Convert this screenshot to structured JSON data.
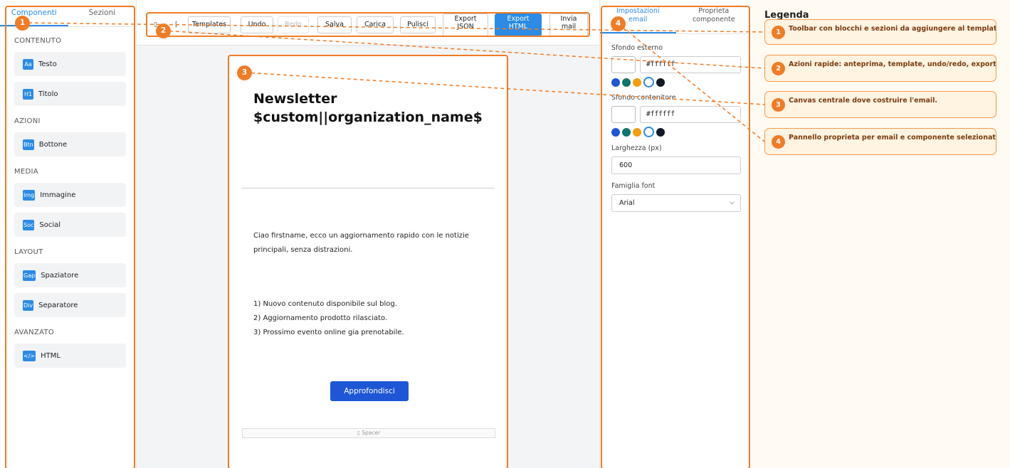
{
  "sidebar": {
    "tabs": [
      "Componenti",
      "Sezioni"
    ],
    "sections": [
      {
        "title": "CONTENUTO",
        "items": [
          {
            "chip": "Aa",
            "label": "Testo"
          },
          {
            "chip": "H1",
            "label": "Titolo"
          }
        ]
      },
      {
        "title": "AZIONI",
        "items": [
          {
            "chip": "Btn",
            "label": "Bottone"
          }
        ]
      },
      {
        "title": "MEDIA",
        "items": [
          {
            "chip": "Img",
            "label": "Immagine"
          },
          {
            "chip": "Soc",
            "label": "Social"
          }
        ]
      },
      {
        "title": "LAYOUT",
        "items": [
          {
            "chip": "Gap",
            "label": "Spaziatore"
          },
          {
            "chip": "Div",
            "label": "Separatore"
          }
        ]
      },
      {
        "title": "AVANZATO",
        "items": [
          {
            "chip": "</>",
            "label": "HTML"
          }
        ]
      }
    ]
  },
  "toolbar": {
    "icon_a": "▯",
    "icon_b": "[",
    "templates": "Templates",
    "undo": "Undo",
    "redo": "Redo",
    "salva": "Salva",
    "carica": "Carica",
    "pulisci": "Pulisci",
    "export_json": [
      "Export",
      "JSON"
    ],
    "export_html": [
      "Export",
      "HTML"
    ],
    "invia_mail": [
      "Invia",
      "mail"
    ]
  },
  "email": {
    "title": "Newsletter $custom||organization_name$",
    "paragraph": "Ciao firstname, ecco un aggiornamento rapido con le notizie principali, senza distrazioni.",
    "list": [
      "1) Nuovo contenuto disponibile sul blog.",
      "2) Aggiornamento prodotto rilasciato.",
      "3) Prossimo evento online gia prenotabile."
    ],
    "cta": "Approfondisci",
    "spacer": "▯ Spacer"
  },
  "props": {
    "tabs": [
      [
        "Impostazioni",
        "email"
      ],
      [
        "Proprieta",
        "componente"
      ]
    ],
    "outer_bg_label": "Sfondo esterno",
    "outer_bg_value": "#ffffff",
    "container_bg_label": "Sfondo contenitore",
    "container_bg_value": "#ffffff",
    "palette": [
      "#1e56d6",
      "#0f766e",
      "#f59e0b",
      "#ffffff",
      "#111827"
    ],
    "width_label": "Larghezza (px)",
    "width_value": "600",
    "font_label": "Famiglia font",
    "font_value": "Arial"
  },
  "legend": {
    "title": "Legenda",
    "items": [
      {
        "num": "1",
        "text": "Toolbar con blocchi e sezioni da aggiungere al template."
      },
      {
        "num": "2",
        "text": "Azioni rapide: anteprima, template, undo/redo, export."
      },
      {
        "num": "3",
        "text": "Canvas centrale dove costruire l'email."
      },
      {
        "num": "4",
        "text": "Pannello proprieta per email e componente selezionato."
      }
    ]
  },
  "badges": [
    "1",
    "2",
    "3",
    "4"
  ],
  "colors": {
    "accent": "#2b8be5",
    "annotation": "#f07c25",
    "cta": "#1e56d6"
  }
}
